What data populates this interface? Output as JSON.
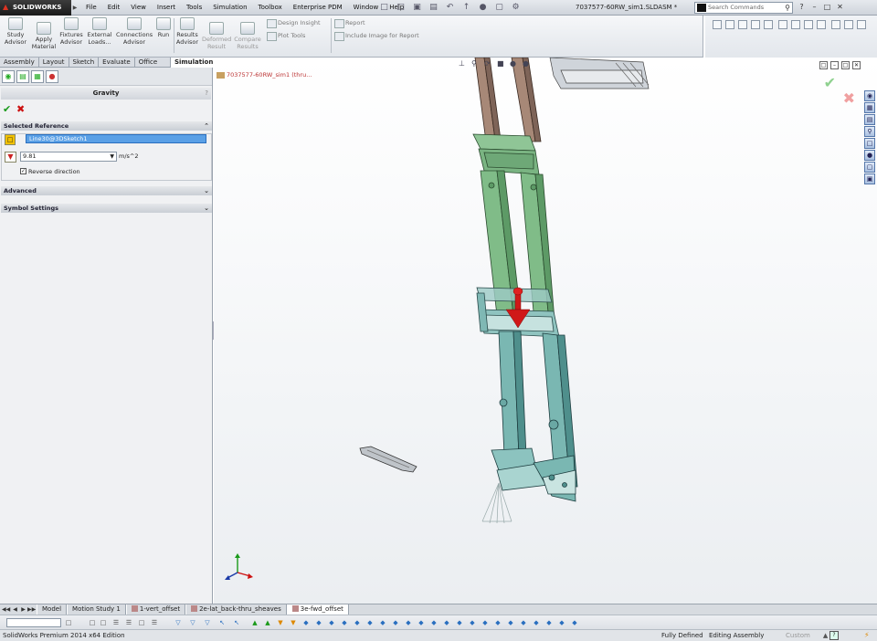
{
  "app": {
    "logo_text": "SOLIDWORKS",
    "document_title": "7037577-60RW_sim1.SLDASM *"
  },
  "menus": [
    "File",
    "Edit",
    "View",
    "Insert",
    "Tools",
    "Simulation",
    "Toolbox",
    "Enterprise PDM",
    "Window",
    "Help"
  ],
  "search": {
    "placeholder": "Search Commands"
  },
  "command_manager": {
    "study_advisor": "Study\nAdvisor",
    "apply_material": "Apply\nMaterial",
    "fixtures_advisor": "Fixtures\nAdvisor",
    "external_loads": "External\nLoads...",
    "connections_advisor": "Connections\nAdvisor",
    "run": "Run",
    "results_advisor": "Results\nAdvisor",
    "deformed_result": "Deformed\nResult",
    "compare_results": "Compare\nResults",
    "design_insight": "Design Insight",
    "plot_tools": "Plot Tools",
    "report": "Report",
    "include_image": "Include Image for Report"
  },
  "tabs": [
    "Assembly",
    "Layout",
    "Sketch",
    "Evaluate",
    "Office Products",
    "Simulation"
  ],
  "active_tab": "Simulation",
  "property_manager": {
    "title": "Gravity",
    "help": "?",
    "selected_reference_header": "Selected Reference",
    "reference_value": "Line30@3DSketch1",
    "gravity_value": "9.81",
    "gravity_unit": "m/s^2",
    "reverse_direction_label": "Reverse direction",
    "reverse_direction_checked": true,
    "advanced_header": "Advanced",
    "symbol_settings_header": "Symbol Settings"
  },
  "graphics": {
    "tree_root": "7037577-60RW_sim1 (thru..."
  },
  "bottom_tabs": [
    "Model",
    "Motion Study 1",
    "1-vert_offset",
    "2e-lat_back-thru_sheaves",
    "3e-fwd_offset"
  ],
  "active_bottom_tab": "3e-fwd_offset",
  "status": {
    "edition": "SolidWorks Premium 2014 x64 Edition",
    "defined": "Fully Defined",
    "editing": "Editing Assembly",
    "units": "Custom"
  },
  "colors": {
    "accent_green": "#1a9a1a",
    "cancel_red": "#cc1111",
    "gravity_arrow": "#d01818",
    "frame_teal": "#6fa8a6",
    "frame_green": "#77b27e",
    "frame_brown": "#a08070"
  }
}
